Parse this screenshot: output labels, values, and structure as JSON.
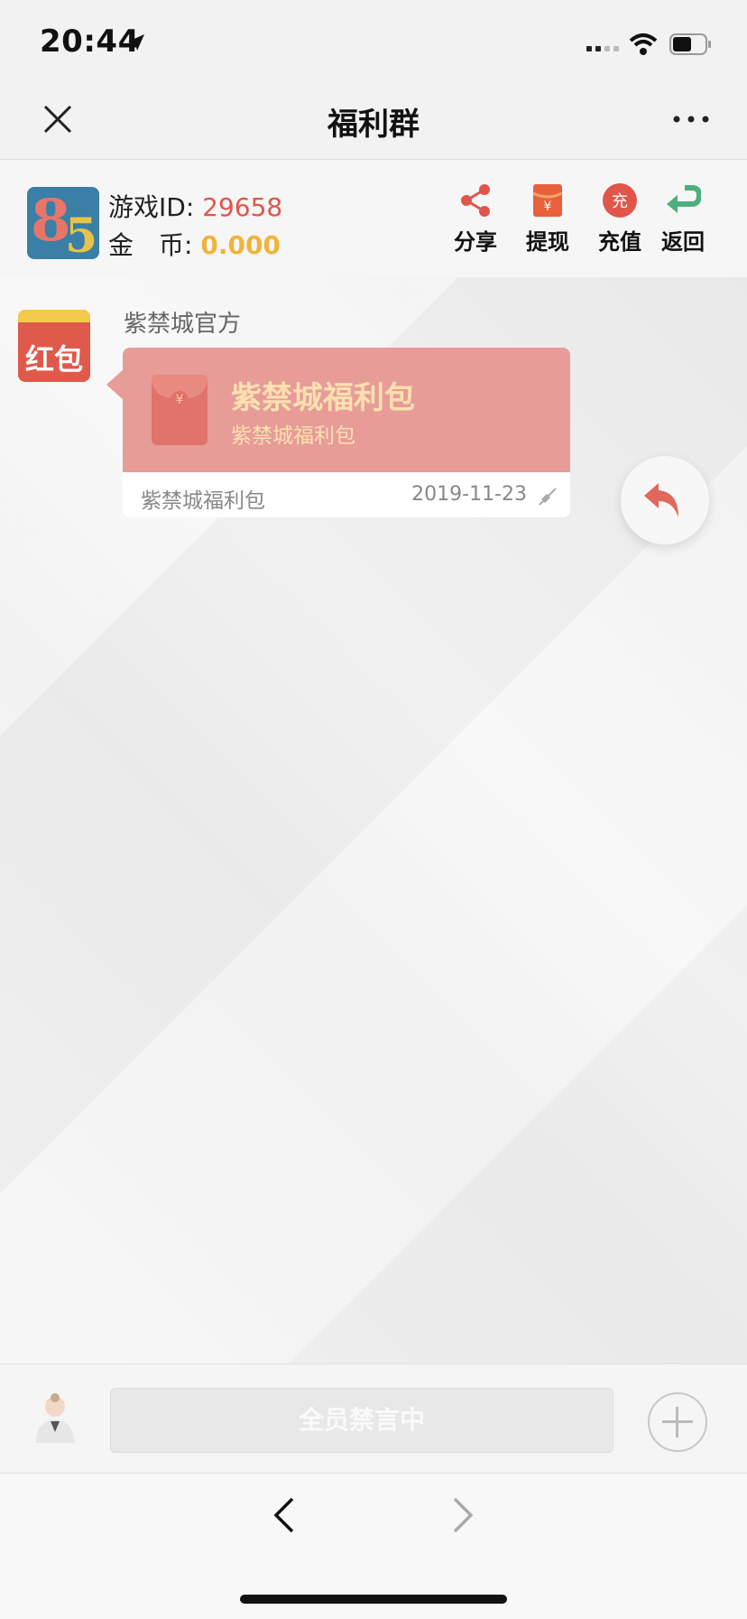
{
  "status_bar": {
    "time": "20:44"
  },
  "nav": {
    "title": "福利群"
  },
  "header": {
    "id_label": "游戏ID:",
    "id_value": "29658",
    "coin_label": "金　币:",
    "coin_value": "0.000",
    "tools": [
      {
        "label": "分享",
        "icon": "share-icon"
      },
      {
        "label": "提现",
        "icon": "withdraw-icon"
      },
      {
        "label": "充值",
        "icon": "recharge-icon",
        "icon_text": "充"
      },
      {
        "label": "返回",
        "icon": "return-icon"
      }
    ]
  },
  "message": {
    "avatar_text": "红包",
    "sender": "紫禁城官方",
    "title": "紫禁城福利包",
    "subtitle": "紫禁城福利包",
    "footer_label": "紫禁城福利包",
    "date": "2019-11-23",
    "envelope_symbol": "¥"
  },
  "input": {
    "placeholder": "全员禁言中"
  },
  "colors": {
    "accent_red": "#e0564a",
    "coin_gold": "#f0b43a",
    "bubble_pink": "#e79c98",
    "bubble_text": "#fbe0b0",
    "return_green": "#4caf7d"
  }
}
